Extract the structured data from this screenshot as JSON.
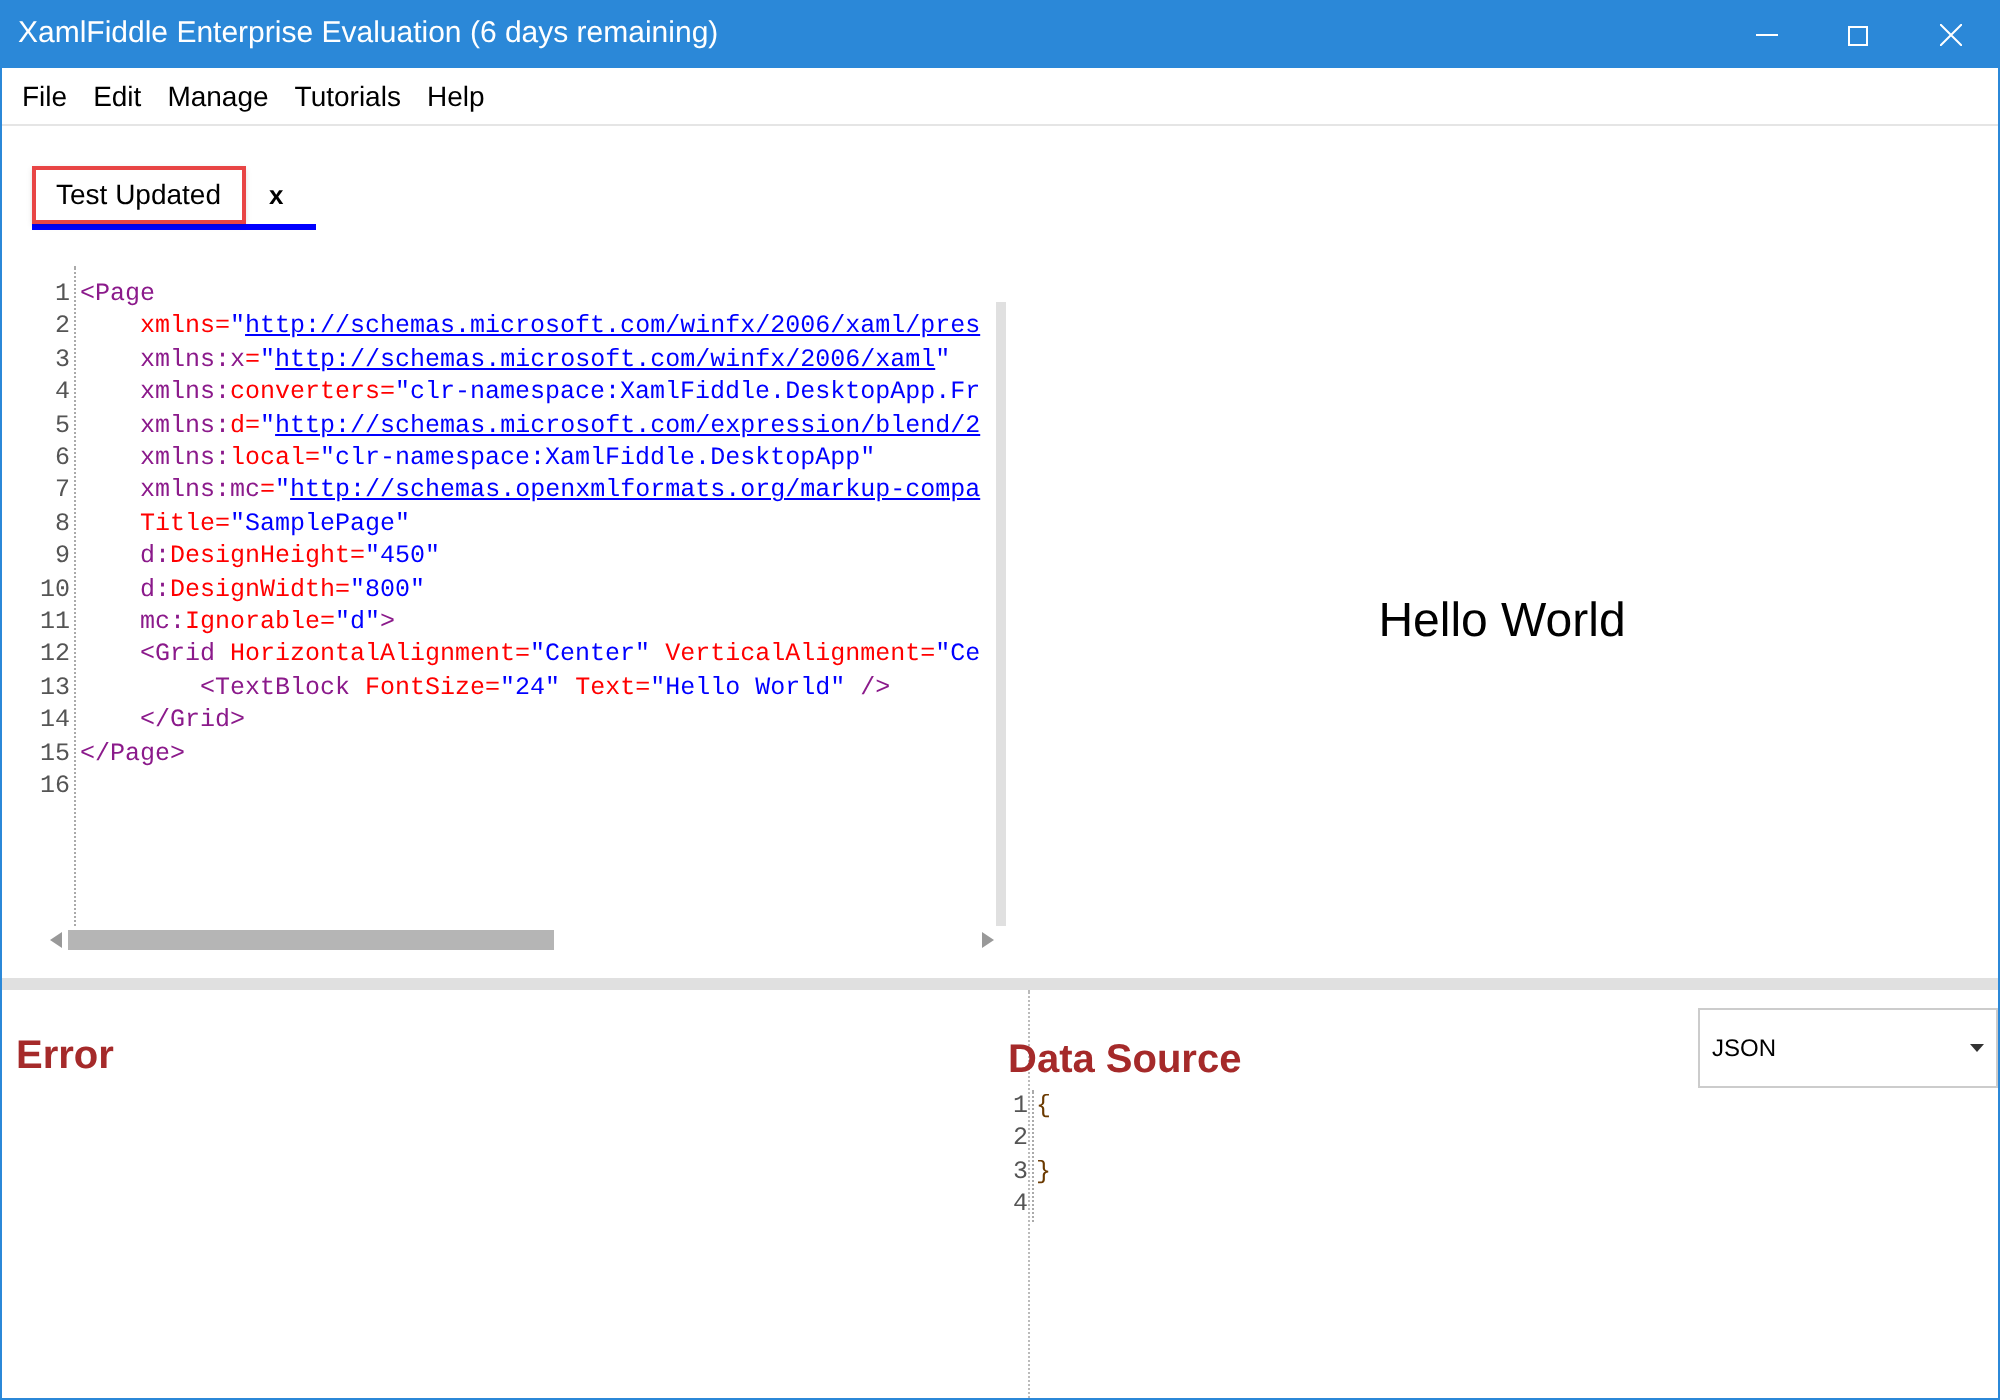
{
  "window": {
    "title": "XamlFiddle Enterprise Evaluation (6 days remaining)"
  },
  "menu": [
    "File",
    "Edit",
    "Manage",
    "Tutorials",
    "Help"
  ],
  "tabs": [
    {
      "label": "Test Updated",
      "selected": true,
      "close": "x"
    }
  ],
  "editor": {
    "lines": [
      {
        "number": "1",
        "tokens": [
          {
            "kind": "tag",
            "text": "<Page"
          }
        ]
      },
      {
        "number": "2",
        "tokens": [
          {
            "kind": "attr",
            "text": "    xmlns="
          },
          {
            "kind": "value",
            "text": "\""
          },
          {
            "kind": "link",
            "text": "http://schemas.microsoft.com/winfx/2006/xaml/pres"
          }
        ]
      },
      {
        "number": "3",
        "tokens": [
          {
            "kind": "tag",
            "text": "    xmlns:x"
          },
          {
            "kind": "attr",
            "text": "="
          },
          {
            "kind": "value",
            "text": "\""
          },
          {
            "kind": "link",
            "text": "http://schemas.microsoft.com/winfx/2006/xaml"
          },
          {
            "kind": "value",
            "text": "\""
          }
        ]
      },
      {
        "number": "4",
        "tokens": [
          {
            "kind": "tag",
            "text": "    xmlns:"
          },
          {
            "kind": "attr",
            "text": "converters="
          },
          {
            "kind": "value",
            "text": "\"clr-namespace:XamlFiddle.DesktopApp.Fr"
          }
        ]
      },
      {
        "number": "5",
        "tokens": [
          {
            "kind": "tag",
            "text": "    xmlns:"
          },
          {
            "kind": "attr",
            "text": "d="
          },
          {
            "kind": "value",
            "text": "\""
          },
          {
            "kind": "link",
            "text": "http://schemas.microsoft.com/expression/blend/2"
          }
        ]
      },
      {
        "number": "6",
        "tokens": [
          {
            "kind": "tag",
            "text": "    xmlns:"
          },
          {
            "kind": "attr",
            "text": "local="
          },
          {
            "kind": "value",
            "text": "\"clr-namespace:XamlFiddle.DesktopApp\""
          }
        ]
      },
      {
        "number": "7",
        "tokens": [
          {
            "kind": "tag",
            "text": "    xmlns:mc"
          },
          {
            "kind": "attr",
            "text": "="
          },
          {
            "kind": "value",
            "text": "\""
          },
          {
            "kind": "link",
            "text": "http://schemas.openxmlformats.org/markup-compa"
          }
        ]
      },
      {
        "number": "8",
        "tokens": [
          {
            "kind": "attr",
            "text": "    Title="
          },
          {
            "kind": "value",
            "text": "\"SamplePage\""
          }
        ]
      },
      {
        "number": "9",
        "tokens": [
          {
            "kind": "tag",
            "text": "    d:"
          },
          {
            "kind": "attr",
            "text": "DesignHeight="
          },
          {
            "kind": "value",
            "text": "\"450\""
          }
        ]
      },
      {
        "number": "10",
        "tokens": [
          {
            "kind": "tag",
            "text": "    d:"
          },
          {
            "kind": "attr",
            "text": "DesignWidth="
          },
          {
            "kind": "value",
            "text": "\"800\""
          }
        ]
      },
      {
        "number": "11",
        "tokens": [
          {
            "kind": "tag",
            "text": "    mc:"
          },
          {
            "kind": "attr",
            "text": "Ignorable="
          },
          {
            "kind": "value",
            "text": "\"d\""
          },
          {
            "kind": "tag",
            "text": ">"
          }
        ]
      },
      {
        "number": "12",
        "tokens": [
          {
            "kind": "tag",
            "text": "    <Grid "
          },
          {
            "kind": "attr",
            "text": "HorizontalAlignment="
          },
          {
            "kind": "value",
            "text": "\"Center\" "
          },
          {
            "kind": "attr",
            "text": "VerticalAlignment="
          },
          {
            "kind": "value",
            "text": "\"Ce"
          }
        ]
      },
      {
        "number": "13",
        "tokens": [
          {
            "kind": "tag",
            "text": "        <TextBlock "
          },
          {
            "kind": "attr",
            "text": "FontSize="
          },
          {
            "kind": "value",
            "text": "\"24\" "
          },
          {
            "kind": "attr",
            "text": "Text="
          },
          {
            "kind": "value",
            "text": "\"Hello World\" "
          },
          {
            "kind": "tag",
            "text": "/>"
          }
        ]
      },
      {
        "number": "14",
        "tokens": [
          {
            "kind": "tag",
            "text": "    </Grid>"
          }
        ]
      },
      {
        "number": "15",
        "tokens": [
          {
            "kind": "tag",
            "text": "</Page>"
          }
        ]
      },
      {
        "number": "16"
      }
    ]
  },
  "preview": {
    "text": "Hello World"
  },
  "error_panel": {
    "title": "Error"
  },
  "data_source": {
    "title": "Data Source",
    "format": "JSON",
    "lines": [
      {
        "number": "1",
        "text": "{"
      },
      {
        "number": "2"
      },
      {
        "number": "3",
        "text": "}"
      },
      {
        "number": "4"
      }
    ]
  }
}
